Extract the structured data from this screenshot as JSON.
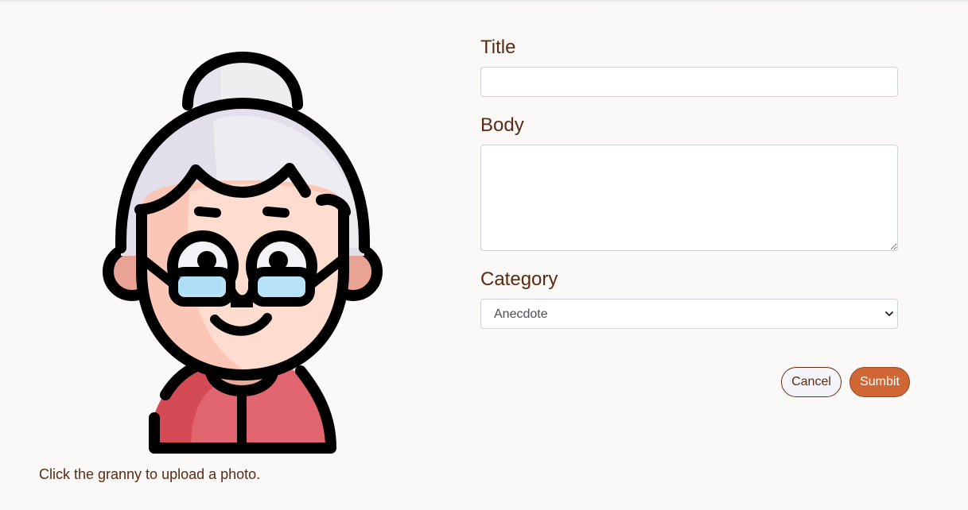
{
  "upload": {
    "hint": "Click the granny to upload a photo."
  },
  "form": {
    "title_label": "Title",
    "title_value": "",
    "body_label": "Body",
    "body_value": "",
    "category_label": "Category",
    "category_selected": "Anecdote",
    "cancel_label": "Cancel",
    "submit_label": "Sumbit"
  },
  "colors": {
    "background": "#fbf9f8",
    "label_text": "#5a2a12",
    "submit_fill": "#cf6634",
    "cancel_fill": "#f3f5fb"
  },
  "icons": [
    "granny-avatar-icon",
    "chevron-down-icon"
  ]
}
